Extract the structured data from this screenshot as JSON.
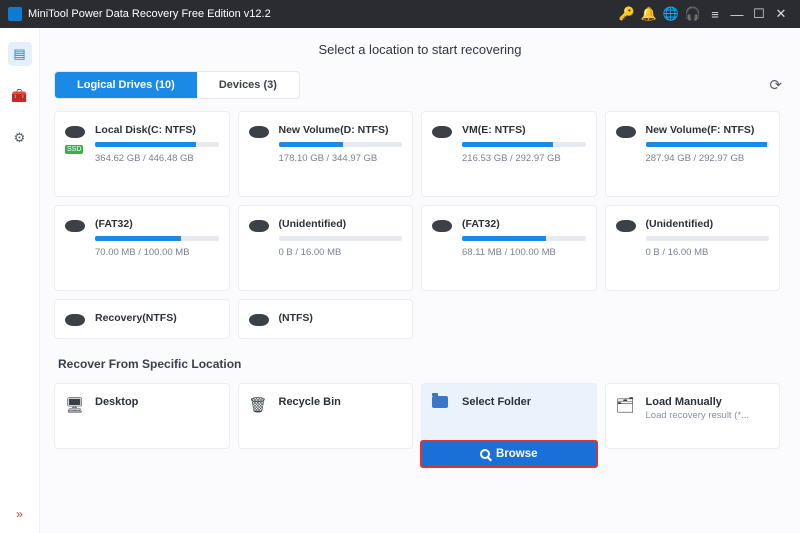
{
  "titlebar": {
    "title": "MiniTool Power Data Recovery Free Edition v12.2"
  },
  "heading": "Select a location to start recovering",
  "tabs": {
    "logical": "Logical Drives (10)",
    "devices": "Devices (3)"
  },
  "drives": [
    {
      "name": "Local Disk(C: NTFS)",
      "size": "364.62 GB / 446.48 GB",
      "pct": 82,
      "ssd": true
    },
    {
      "name": "New Volume(D: NTFS)",
      "size": "178.10 GB / 344.97 GB",
      "pct": 52
    },
    {
      "name": "VM(E: NTFS)",
      "size": "216.53 GB / 292.97 GB",
      "pct": 74
    },
    {
      "name": "New Volume(F: NTFS)",
      "size": "287.94 GB / 292.97 GB",
      "pct": 98
    },
    {
      "name": "(FAT32)",
      "size": "70.00 MB / 100.00 MB",
      "pct": 70
    },
    {
      "name": "(Unidentified)",
      "size": "0 B / 16.00 MB",
      "pct": 0
    },
    {
      "name": "(FAT32)",
      "size": "68.11 MB / 100.00 MB",
      "pct": 68
    },
    {
      "name": "(Unidentified)",
      "size": "0 B / 16.00 MB",
      "pct": 0
    },
    {
      "name": "Recovery(NTFS)",
      "size": "",
      "pct": 0,
      "partial": true
    },
    {
      "name": "(NTFS)",
      "size": "",
      "pct": 0,
      "partial": true
    }
  ],
  "section_title": "Recover From Specific Location",
  "locations": {
    "desktop": "Desktop",
    "recycle": "Recycle Bin",
    "select_folder": "Select Folder",
    "load_manually": "Load Manually",
    "load_sub": "Load recovery result (*...",
    "browse": "Browse"
  }
}
